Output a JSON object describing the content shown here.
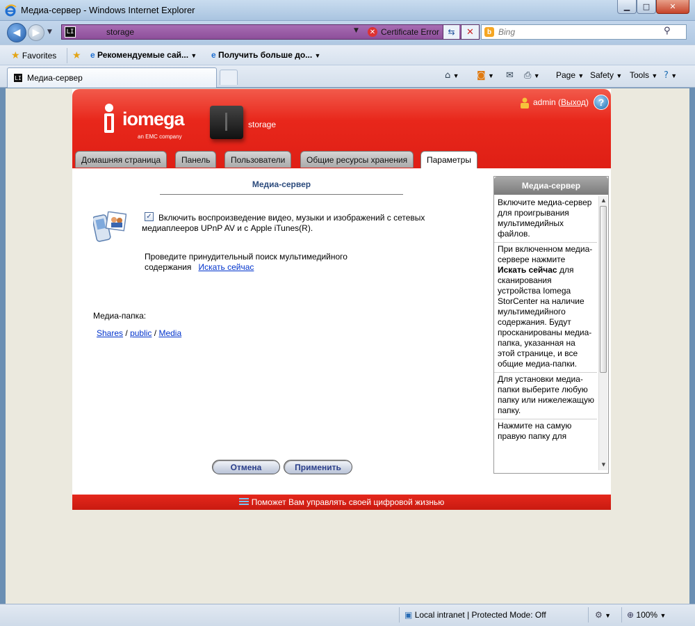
{
  "window": {
    "title": "Медиа-сервер - Windows Internet Explorer",
    "min_glyph": "▁",
    "max_glyph": "□",
    "close_glyph": "✕"
  },
  "nav": {
    "address": "storage",
    "cert_error": "Certificate Error",
    "search_placeholder": "Bing"
  },
  "favorites": {
    "label": "Favorites",
    "items": [
      "Рекомендуемые сай...",
      "Получить больше до..."
    ]
  },
  "tab": {
    "title": "Медиа-сервер"
  },
  "commands": {
    "page": "Page",
    "safety": "Safety",
    "tools": "Tools"
  },
  "header": {
    "logo_text": "iomega",
    "logo_sub": "an EMC company",
    "device_name": "storage",
    "user": "admin",
    "logout": "Выход"
  },
  "tabs": [
    {
      "label": "Домашняя страница",
      "active": false
    },
    {
      "label": "Панель",
      "active": false
    },
    {
      "label": "Пользователи",
      "active": false
    },
    {
      "label": "Общие ресурсы хранения",
      "active": false
    },
    {
      "label": "Параметры",
      "active": true
    }
  ],
  "content": {
    "title": "Медиа-сервер",
    "enable_label": "Включить воспроизведение видео, музыки и изображений с сетевых медиаплееров UPnP AV и с Apple iTunes(R).",
    "enable_checked": true,
    "scan_text": "Проведите принудительный поиск мультимедийного содержания",
    "scan_link": "Искать сейчас",
    "folder_label": "Медиа-папка:",
    "folder_path": [
      {
        "text": "Shares",
        "sep": "/"
      },
      {
        "text": "public",
        "sep": "/"
      },
      {
        "text": "Media",
        "sep": ""
      }
    ],
    "cancel": "Отмена",
    "apply": "Применить"
  },
  "help": {
    "title": "Медиа-сервер",
    "p1": "Включите медиа-сервер для проигрывания мультимедийных файлов.",
    "p2_pre": "При включенном медиа-сервере нажмите ",
    "p2_bold": "Искать сейчас",
    "p2_post": " для сканирования устройства Iomega StorCenter на наличие мультимедийного содержания. Будут просканированы медиа-папка, указанная на этой странице, и все общие медиа-папки.",
    "p3": "Для установки медиа-папки выберите любую папку или нижележащую папку.",
    "p4": "Нажмите на самую правую папку для"
  },
  "footer": {
    "text": "Поможет Вам управлять своей цифровой жизнью"
  },
  "status": {
    "zone": "Local intranet | Protected Mode: Off",
    "zoom": "100%"
  },
  "colors": {
    "brand_red": "#e8271b",
    "link": "#0033cc",
    "title_blue": "#2b4a7c"
  }
}
